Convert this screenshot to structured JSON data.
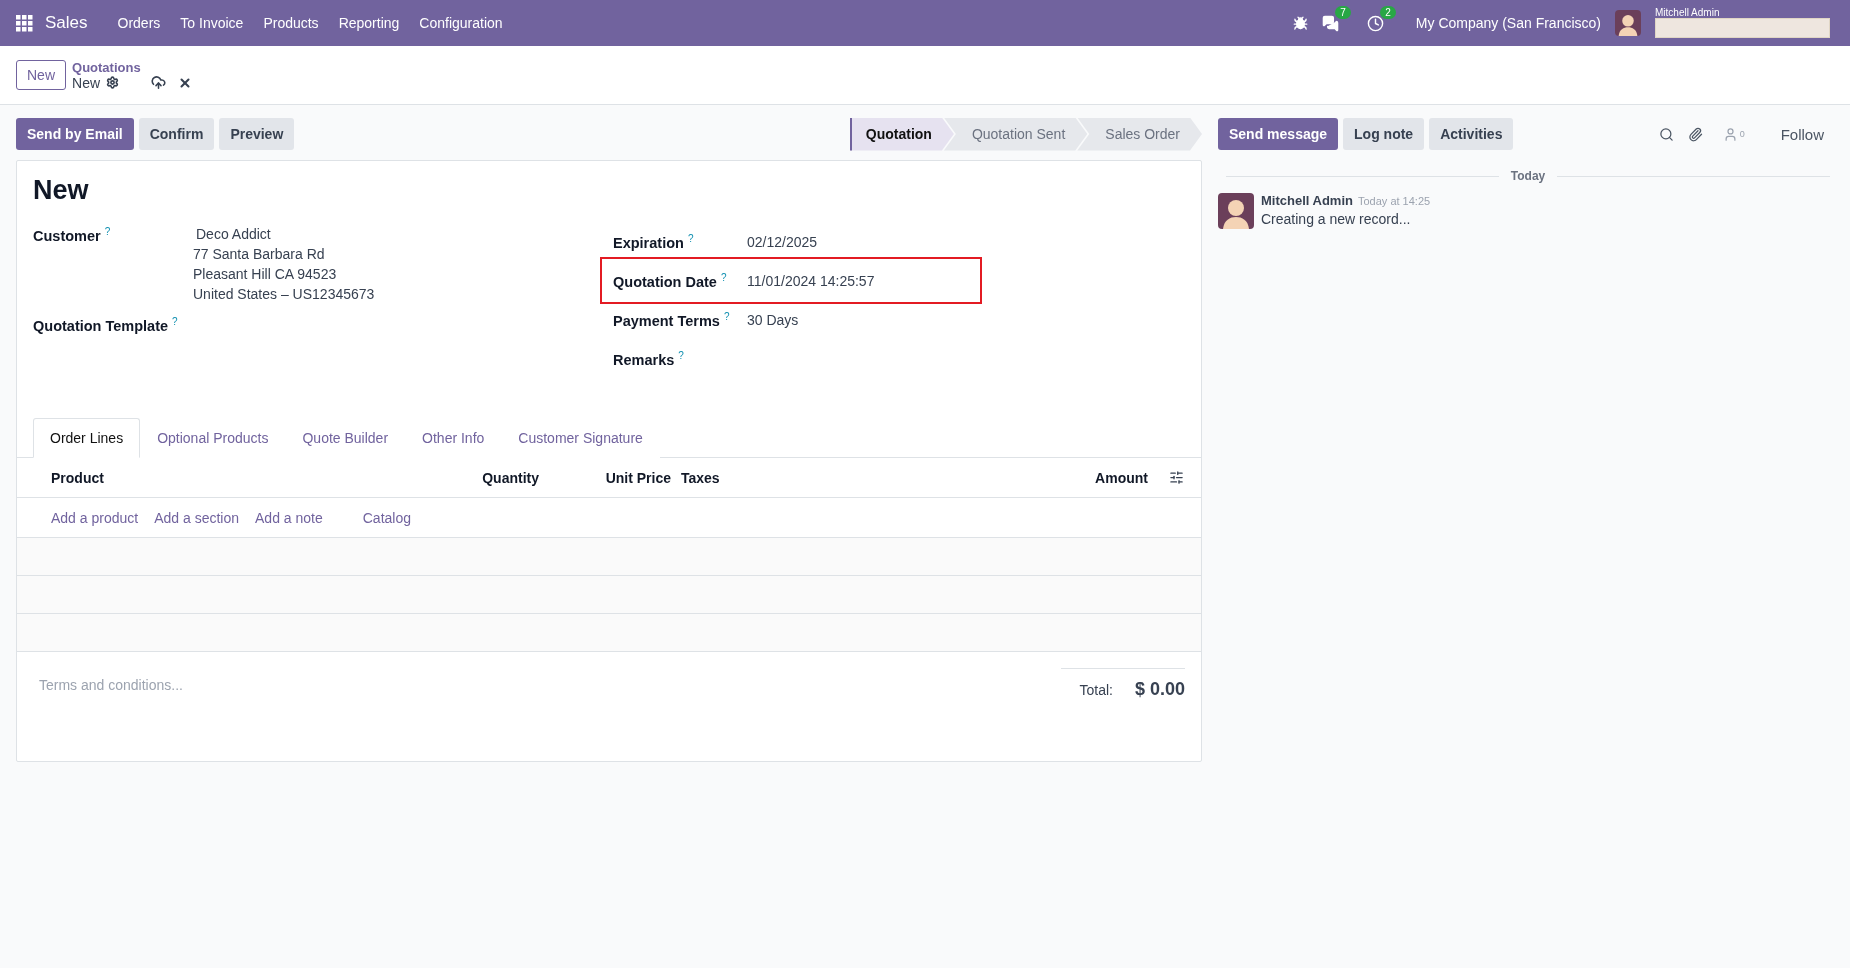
{
  "navbar": {
    "app": "Sales",
    "menu": [
      "Orders",
      "To Invoice",
      "Products",
      "Reporting",
      "Configuration"
    ],
    "messages_badge": "7",
    "activities_badge": "2",
    "company": "My Company (San Francisco)",
    "user": "Mitchell Admin"
  },
  "control_panel": {
    "new_button": "New",
    "breadcrumb": "Quotations",
    "record": "New"
  },
  "actions": [
    {
      "label": "Send by Email",
      "primary": true
    },
    {
      "label": "Confirm",
      "primary": false
    },
    {
      "label": "Preview",
      "primary": false
    }
  ],
  "statusbar": [
    {
      "label": "Quotation",
      "selected": true
    },
    {
      "label": "Quotation Sent",
      "selected": false
    },
    {
      "label": "Sales Order",
      "selected": false
    }
  ],
  "form": {
    "title": "New",
    "left_fields": [
      {
        "label": "Customer",
        "help": "?",
        "lines": [
          "Deco Addict",
          "77 Santa Barbara Rd",
          "Pleasant Hill CA 94523",
          "United States – US12345673"
        ]
      },
      {
        "label": "Quotation Template",
        "help": "?"
      }
    ],
    "right_fields": [
      {
        "label": "Expiration",
        "help": "?",
        "value": "02/12/2025",
        "highlighted": false
      },
      {
        "label": "Quotation Date",
        "help": "?",
        "value": "11/01/2024 14:25:57",
        "highlighted": true
      },
      {
        "label": "Payment Terms",
        "help": "?",
        "value": "30 Days",
        "highlighted": false
      },
      {
        "label": "Remarks",
        "help": "?",
        "highlighted": false
      }
    ]
  },
  "tabs": [
    {
      "label": "Order Lines",
      "selected": true
    },
    {
      "label": "Optional Products",
      "selected": false
    },
    {
      "label": "Quote Builder",
      "selected": false
    },
    {
      "label": "Other Info",
      "selected": false
    },
    {
      "label": "Customer Signature",
      "selected": false
    }
  ],
  "order_lines": {
    "columns": [
      "Product",
      "Quantity",
      "Unit Price",
      "Taxes",
      "Amount"
    ],
    "add_links": [
      "Add a product",
      "Add a section",
      "Add a note",
      "Catalog"
    ]
  },
  "terms": {
    "placeholder": "Terms and conditions..."
  },
  "total": {
    "label": "Total:",
    "value": "$ 0.00"
  },
  "chatter": {
    "buttons": [
      {
        "label": "Send message",
        "primary": true
      },
      {
        "label": "Log note",
        "primary": false
      },
      {
        "label": "Activities",
        "primary": false
      }
    ],
    "followers": "0",
    "follow": "Follow",
    "date_divider": "Today",
    "messages": [
      {
        "author": "Mitchell Admin",
        "time": "Today at 14:25",
        "body": "Creating a new record..."
      }
    ]
  }
}
